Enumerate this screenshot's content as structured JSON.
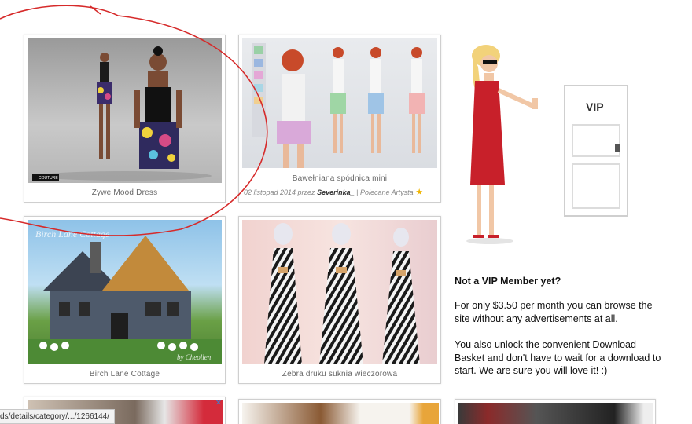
{
  "cards": [
    {
      "caption": "Żywe Mood Dress"
    },
    {
      "caption": "Bawełniana spódnica mini",
      "date": "02 listopad 2014 przez ",
      "author": "Severinka_",
      "separator": " | ",
      "badge": "Polecane Artysta"
    },
    {
      "caption": "Birch Lane Cottage"
    },
    {
      "caption": "Zebra druku suknia wieczorowa"
    }
  ],
  "thumb_texts": {
    "brand_tag": "COUTURE",
    "cottage_watermark": "Birch Lane Cottage",
    "cottage_signature": "by Cheollen",
    "vip_door": "VIP"
  },
  "vip": {
    "title": "Not a VIP Member yet?",
    "p1": "For only $3.50 per month you can browse the site without any advertisements at all.",
    "p2": "You also unlock the convenient Download Basket and don't have to wait for a download to start. We are sure you will love it! :)"
  },
  "status_url": "ds/details/category/.../1266144/",
  "ad_close": "✕",
  "colors": {
    "annotation_red": "#d62a2a",
    "star": "#f0b400",
    "card_border": "#cfcfcf"
  }
}
